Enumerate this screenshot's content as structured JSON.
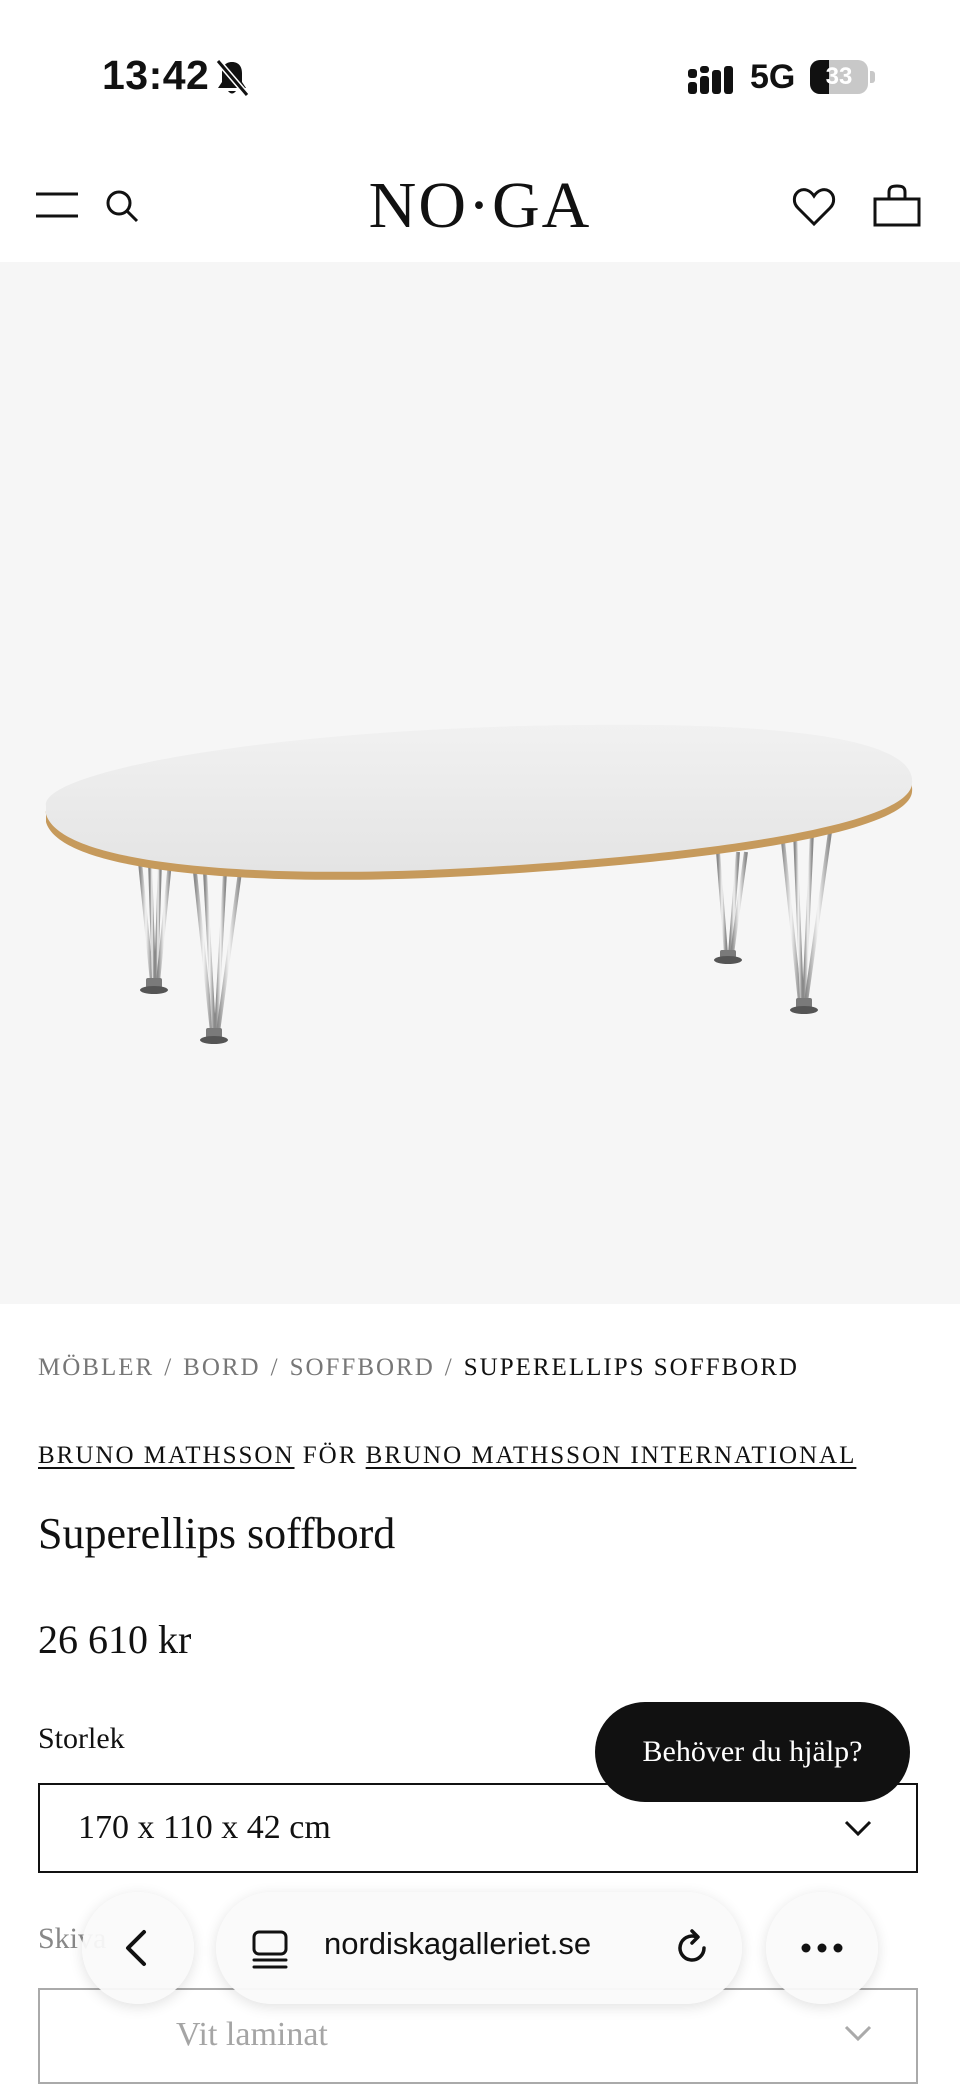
{
  "status_bar": {
    "time": "13:42",
    "network": "5G",
    "battery_percent": "33",
    "battery_level": 0.33,
    "icons": [
      "bell-slash-icon",
      "signal-bars-icon",
      "battery-icon"
    ]
  },
  "header": {
    "logo": "NO·GA",
    "icons": [
      "menu-icon",
      "search-icon",
      "heart-icon",
      "shopping-bag-icon"
    ]
  },
  "product_image": {
    "icon": "coffee-table-image"
  },
  "breadcrumb": {
    "items": [
      "MÖBLER",
      "BORD",
      "SOFFBORD"
    ],
    "current": "SUPERELLIPS SOFFBORD",
    "separator": "/"
  },
  "brand": {
    "designer": "BRUNO MATHSSON",
    "connector": "FÖR",
    "manufacturer": "BRUNO MATHSSON INTERNATIONAL"
  },
  "product": {
    "title": "Superellips soffbord",
    "price": "26 610 kr"
  },
  "options": {
    "size_label": "Storlek",
    "size_value": "170 x 110 x 42 cm",
    "finish_label": "Skiva",
    "finish_value": "Vit laminat"
  },
  "help": {
    "label": "Behöver du hjälp?"
  },
  "browser": {
    "url": "nordiskagalleriet.se",
    "icons": [
      "back-icon",
      "tabs-icon",
      "reload-icon",
      "more-icon"
    ]
  },
  "colors": {
    "text": "#111111",
    "muted": "#777777",
    "hero_bg": "#f6f6f6",
    "tabletop": "#ebebeb",
    "table_edge": "#c69a5c",
    "help_bg": "#111111"
  }
}
